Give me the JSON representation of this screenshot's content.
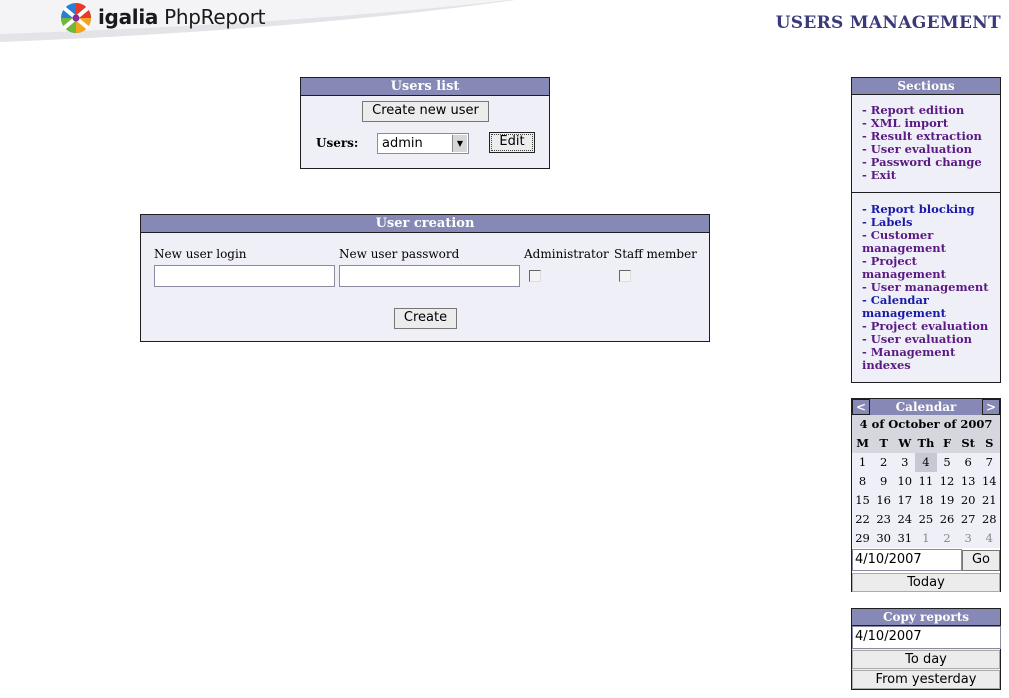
{
  "header": {
    "logo_brand": "igalia",
    "logo_product": "PhpReport",
    "page_title": "USERS MANAGEMENT"
  },
  "users_list": {
    "title": "Users list",
    "create_button": "Create new user",
    "users_label": "Users:",
    "selected_user": "admin",
    "edit_button": "Edit"
  },
  "user_creation": {
    "title": "User creation",
    "login_label": "New user login",
    "password_label": "New user password",
    "admin_label": "Administrator",
    "staff_label": "Staff member",
    "login_value": "",
    "password_value": "",
    "administrator_checked": false,
    "staff_checked": false,
    "create_button": "Create"
  },
  "sections": {
    "title": "Sections",
    "group1": [
      {
        "label": "- Report edition"
      },
      {
        "label": "- XML import"
      },
      {
        "label": "- Result extraction"
      },
      {
        "label": "- User evaluation"
      },
      {
        "label": "- Password change"
      },
      {
        "label": "- Exit"
      }
    ],
    "group2": [
      {
        "label": "- Report blocking",
        "color": "blue"
      },
      {
        "label": "- Labels",
        "color": "blue"
      },
      {
        "label": "- Customer management"
      },
      {
        "label": "- Project management"
      },
      {
        "label": "- User management"
      },
      {
        "label": "- Calendar management",
        "color": "blue"
      },
      {
        "label": "- Project evaluation"
      },
      {
        "label": "- User evaluation"
      },
      {
        "label": "- Management indexes"
      }
    ]
  },
  "calendar": {
    "title": "Calendar",
    "prev": "<",
    "next": ">",
    "date_title": "4 of October of 2007",
    "weekdays": [
      "M",
      "T",
      "W",
      "Th",
      "F",
      "St",
      "S"
    ],
    "weeks": [
      [
        "1",
        "2",
        "3",
        "4",
        "5",
        "6",
        "7"
      ],
      [
        "8",
        "9",
        "10",
        "11",
        "12",
        "13",
        "14"
      ],
      [
        "15",
        "16",
        "17",
        "18",
        "19",
        "20",
        "21"
      ],
      [
        "22",
        "23",
        "24",
        "25",
        "26",
        "27",
        "28"
      ],
      [
        "29",
        "30",
        "31",
        "1",
        "2",
        "3",
        "4"
      ]
    ],
    "selected_day": "4",
    "date_input": "4/10/2007",
    "go_button": "Go",
    "today_button": "Today"
  },
  "copy_reports": {
    "title": "Copy reports",
    "date_input": "4/10/2007",
    "to_day_button": "To day",
    "from_yesterday_button": "From yesterday"
  },
  "colors": {
    "panel_header": "#8689b5",
    "panel_body": "#efeff8",
    "title_color": "#3a3a7a",
    "link_purple": "#5a1a82",
    "link_blue": "#1a1aa8"
  }
}
